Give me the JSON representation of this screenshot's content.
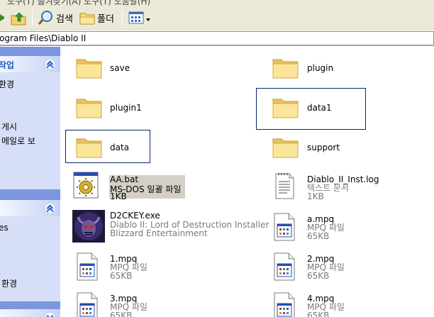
{
  "menu": {
    "label": "도구(T)   즐겨찾기(A)   도구(T)   도움말(H)"
  },
  "toolbar": {
    "search_label": "검색",
    "folders_label": "폴더"
  },
  "address": {
    "path": "ogram Files\\Diablo II"
  },
  "taskpane": {
    "section1_title": "작업",
    "section1_links": [
      "환경",
      "게시",
      "메일로 보"
    ],
    "section2_title": "",
    "section2_links": [
      "es",
      "환경"
    ]
  },
  "files": [
    {
      "name": "save",
      "type": "folder"
    },
    {
      "name": "plugin",
      "type": "folder"
    },
    {
      "name": "plugin1",
      "type": "folder"
    },
    {
      "name": "data1",
      "type": "folder"
    },
    {
      "name": "data",
      "type": "folder"
    },
    {
      "name": "support",
      "type": "folder"
    },
    {
      "name": "AA.bat",
      "line2": "MS-DOS 일괄 파일",
      "line3": "1KB",
      "type": "bat"
    },
    {
      "name": "Diablo_II_Inst.log",
      "line2": "텍스트 문서",
      "line3": "1KB",
      "type": "log"
    },
    {
      "name": "D2CKEY.exe",
      "line2": "Diablo II: Lord of Destruction Installer",
      "line3": "Blizzard Entertainment",
      "type": "exe"
    },
    {
      "name": "a.mpq",
      "line2": "MPQ 파일",
      "line3": "65KB",
      "type": "mpq"
    },
    {
      "name": "1.mpq",
      "line2": "MPQ 파일",
      "line3": "65KB",
      "type": "mpq"
    },
    {
      "name": "2.mpq",
      "line2": "MPQ 파일",
      "line3": "65KB",
      "type": "mpq"
    },
    {
      "name": "3.mpq",
      "line2": "MPQ 파일",
      "line3": "65KB",
      "type": "mpq"
    },
    {
      "name": "4.mpq",
      "line2": "MPQ 파일",
      "line3": "65KB",
      "type": "mpq"
    }
  ],
  "colors": {
    "taskpane_bg": "#d6dff7",
    "taskpane_title": "#215dc6",
    "selection_border": "#0a246a"
  }
}
